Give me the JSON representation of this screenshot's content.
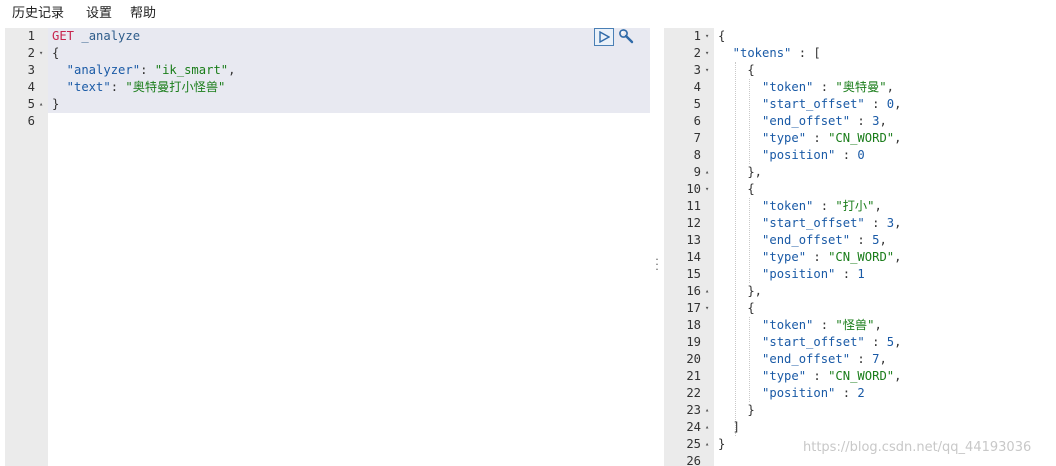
{
  "menu": {
    "items": [
      {
        "label": "历史记录"
      },
      {
        "label": "设置"
      },
      {
        "label": "帮助"
      }
    ]
  },
  "request": {
    "lines": [
      {
        "num": "1",
        "fold": "",
        "tokens": [
          {
            "t": "GET",
            "c": "k-method"
          },
          {
            "t": " _analyze",
            "c": "k-url"
          }
        ]
      },
      {
        "num": "2",
        "fold": "▾",
        "tokens": [
          {
            "t": "{",
            "c": "k-punc"
          }
        ]
      },
      {
        "num": "3",
        "fold": "",
        "tokens": [
          {
            "t": "  \"analyzer\"",
            "c": "k-key"
          },
          {
            "t": ": ",
            "c": "k-punc"
          },
          {
            "t": "\"ik_smart\"",
            "c": "k-str"
          },
          {
            "t": ",",
            "c": "k-punc"
          }
        ]
      },
      {
        "num": "4",
        "fold": "",
        "tokens": [
          {
            "t": "  \"text\"",
            "c": "k-key"
          },
          {
            "t": ": ",
            "c": "k-punc"
          },
          {
            "t": "\"奥特曼打小怪兽\"",
            "c": "k-str"
          }
        ]
      },
      {
        "num": "5",
        "fold": "▴",
        "tokens": [
          {
            "t": "}",
            "c": "k-punc"
          }
        ]
      },
      {
        "num": "6",
        "fold": "",
        "tokens": []
      }
    ]
  },
  "response": {
    "lines": [
      {
        "num": "1",
        "fold": "▾",
        "tokens": [
          {
            "t": "{",
            "c": "k-punc"
          }
        ]
      },
      {
        "num": "2",
        "fold": "▾",
        "tokens": [
          {
            "t": "  \"tokens\"",
            "c": "k-key"
          },
          {
            "t": " : [",
            "c": "k-punc"
          }
        ]
      },
      {
        "num": "3",
        "fold": "▾",
        "tokens": [
          {
            "t": "    {",
            "c": "k-punc"
          }
        ]
      },
      {
        "num": "4",
        "fold": "",
        "tokens": [
          {
            "t": "      \"token\"",
            "c": "k-key"
          },
          {
            "t": " : ",
            "c": "k-punc"
          },
          {
            "t": "\"奥特曼\"",
            "c": "k-str"
          },
          {
            "t": ",",
            "c": "k-punc"
          }
        ]
      },
      {
        "num": "5",
        "fold": "",
        "tokens": [
          {
            "t": "      \"start_offset\"",
            "c": "k-key"
          },
          {
            "t": " : ",
            "c": "k-punc"
          },
          {
            "t": "0",
            "c": "k-num"
          },
          {
            "t": ",",
            "c": "k-punc"
          }
        ]
      },
      {
        "num": "6",
        "fold": "",
        "tokens": [
          {
            "t": "      \"end_offset\"",
            "c": "k-key"
          },
          {
            "t": " : ",
            "c": "k-punc"
          },
          {
            "t": "3",
            "c": "k-num"
          },
          {
            "t": ",",
            "c": "k-punc"
          }
        ]
      },
      {
        "num": "7",
        "fold": "",
        "tokens": [
          {
            "t": "      \"type\"",
            "c": "k-key"
          },
          {
            "t": " : ",
            "c": "k-punc"
          },
          {
            "t": "\"CN_WORD\"",
            "c": "k-str"
          },
          {
            "t": ",",
            "c": "k-punc"
          }
        ]
      },
      {
        "num": "8",
        "fold": "",
        "tokens": [
          {
            "t": "      \"position\"",
            "c": "k-key"
          },
          {
            "t": " : ",
            "c": "k-punc"
          },
          {
            "t": "0",
            "c": "k-num"
          }
        ]
      },
      {
        "num": "9",
        "fold": "▴",
        "tokens": [
          {
            "t": "    },",
            "c": "k-punc"
          }
        ]
      },
      {
        "num": "10",
        "fold": "▾",
        "tokens": [
          {
            "t": "    {",
            "c": "k-punc"
          }
        ]
      },
      {
        "num": "11",
        "fold": "",
        "tokens": [
          {
            "t": "      \"token\"",
            "c": "k-key"
          },
          {
            "t": " : ",
            "c": "k-punc"
          },
          {
            "t": "\"打小\"",
            "c": "k-str"
          },
          {
            "t": ",",
            "c": "k-punc"
          }
        ]
      },
      {
        "num": "12",
        "fold": "",
        "tokens": [
          {
            "t": "      \"start_offset\"",
            "c": "k-key"
          },
          {
            "t": " : ",
            "c": "k-punc"
          },
          {
            "t": "3",
            "c": "k-num"
          },
          {
            "t": ",",
            "c": "k-punc"
          }
        ]
      },
      {
        "num": "13",
        "fold": "",
        "tokens": [
          {
            "t": "      \"end_offset\"",
            "c": "k-key"
          },
          {
            "t": " : ",
            "c": "k-punc"
          },
          {
            "t": "5",
            "c": "k-num"
          },
          {
            "t": ",",
            "c": "k-punc"
          }
        ]
      },
      {
        "num": "14",
        "fold": "",
        "tokens": [
          {
            "t": "      \"type\"",
            "c": "k-key"
          },
          {
            "t": " : ",
            "c": "k-punc"
          },
          {
            "t": "\"CN_WORD\"",
            "c": "k-str"
          },
          {
            "t": ",",
            "c": "k-punc"
          }
        ]
      },
      {
        "num": "15",
        "fold": "",
        "tokens": [
          {
            "t": "      \"position\"",
            "c": "k-key"
          },
          {
            "t": " : ",
            "c": "k-punc"
          },
          {
            "t": "1",
            "c": "k-num"
          }
        ]
      },
      {
        "num": "16",
        "fold": "▴",
        "tokens": [
          {
            "t": "    },",
            "c": "k-punc"
          }
        ]
      },
      {
        "num": "17",
        "fold": "▾",
        "tokens": [
          {
            "t": "    {",
            "c": "k-punc"
          }
        ]
      },
      {
        "num": "18",
        "fold": "",
        "tokens": [
          {
            "t": "      \"token\"",
            "c": "k-key"
          },
          {
            "t": " : ",
            "c": "k-punc"
          },
          {
            "t": "\"怪兽\"",
            "c": "k-str"
          },
          {
            "t": ",",
            "c": "k-punc"
          }
        ]
      },
      {
        "num": "19",
        "fold": "",
        "tokens": [
          {
            "t": "      \"start_offset\"",
            "c": "k-key"
          },
          {
            "t": " : ",
            "c": "k-punc"
          },
          {
            "t": "5",
            "c": "k-num"
          },
          {
            "t": ",",
            "c": "k-punc"
          }
        ]
      },
      {
        "num": "20",
        "fold": "",
        "tokens": [
          {
            "t": "      \"end_offset\"",
            "c": "k-key"
          },
          {
            "t": " : ",
            "c": "k-punc"
          },
          {
            "t": "7",
            "c": "k-num"
          },
          {
            "t": ",",
            "c": "k-punc"
          }
        ]
      },
      {
        "num": "21",
        "fold": "",
        "tokens": [
          {
            "t": "      \"type\"",
            "c": "k-key"
          },
          {
            "t": " : ",
            "c": "k-punc"
          },
          {
            "t": "\"CN_WORD\"",
            "c": "k-str"
          },
          {
            "t": ",",
            "c": "k-punc"
          }
        ]
      },
      {
        "num": "22",
        "fold": "",
        "tokens": [
          {
            "t": "      \"position\"",
            "c": "k-key"
          },
          {
            "t": " : ",
            "c": "k-punc"
          },
          {
            "t": "2",
            "c": "k-num"
          }
        ]
      },
      {
        "num": "23",
        "fold": "▴",
        "tokens": [
          {
            "t": "    }",
            "c": "k-punc"
          }
        ]
      },
      {
        "num": "24",
        "fold": "▴",
        "tokens": [
          {
            "t": "  ]",
            "c": "k-punc"
          }
        ]
      },
      {
        "num": "25",
        "fold": "▴",
        "tokens": [
          {
            "t": "}",
            "c": "k-punc"
          }
        ]
      },
      {
        "num": "26",
        "fold": "",
        "tokens": []
      }
    ]
  },
  "icons": {
    "run": "play-icon",
    "settings": "wrench-icon",
    "divider": "vertical-ellipsis-icon"
  },
  "colors": {
    "method": "#c7254e",
    "key": "#1a5aa6",
    "string": "#1a7d1a",
    "highlight": "#e8e9f1",
    "gutter": "#ebebeb"
  },
  "watermark": {
    "text": "https://blog.csdn.net/qq_44193036"
  }
}
